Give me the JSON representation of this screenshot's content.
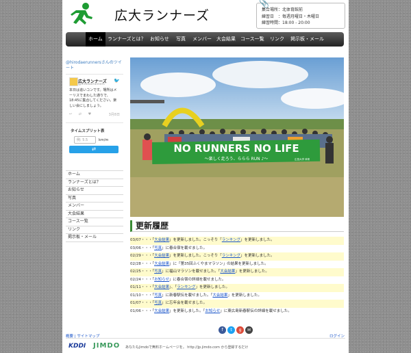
{
  "header": {
    "title": "広大ランナーズ",
    "info": {
      "place": "集合場所：北体育館前",
      "day": "練習日　：毎週月曜日・木曜日",
      "time": "練習時間：18:00 - 20:00"
    }
  },
  "nav": {
    "items": [
      "ホーム",
      "ランナーズとは？",
      "お知らせ",
      "写真",
      "メンバー",
      "大会結果",
      "コース一覧",
      "リンク",
      "掲示板・メール"
    ]
  },
  "twitter": {
    "heading": "@hirodaerunnersさんのツイート",
    "name": "広大ランナーズ",
    "handle": "@hirodaerunners",
    "body": "本日は追いコンです。場所はメーリスでまわした通りで、18:45に集合してください。楽しい会にしましょう。",
    "time": "3月8日"
  },
  "split": {
    "title": "タイムスプリット表",
    "label": "km/h",
    "placeholder": "例: 5.5",
    "unit": "km/m",
    "button": "⇄"
  },
  "sidenav": {
    "items": [
      "ホーム",
      "ランナーズとは？",
      "お知らせ",
      "写真",
      "メンバー",
      "大会結果",
      "コース一覧",
      "リンク",
      "掲示板・メール"
    ]
  },
  "hero": {
    "banner_main": "NO RUNNERS NO LIFE",
    "banner_sub": "〜楽しく走ろう、ららら RUN ♪〜",
    "banner_side": "広島大学 体育"
  },
  "main": {
    "section_title": "更新履歴",
    "updates": [
      {
        "date": "03/07",
        "pre": "・・・「",
        "link1": "大会結果",
        "mid": "」を更新しました。こっそり「",
        "link2": "ランキング",
        "post": "」を更新しました。"
      },
      {
        "date": "03/06",
        "pre": "・・・「",
        "link1": "写真",
        "mid": "」に春合宿を載せました。",
        "link2": "",
        "post": ""
      },
      {
        "date": "02/29",
        "pre": "・・・「",
        "link1": "大会結果",
        "mid": "」を更新しました。こっそり「",
        "link2": "ランキング",
        "post": "」を更新しました。"
      },
      {
        "date": "02/28",
        "pre": "・・・「",
        "link1": "大会結果",
        "mid": "」に「第35回ふくやまマラソン」の結果を更新しました。",
        "link2": "",
        "post": ""
      },
      {
        "date": "02/25",
        "pre": "・・・「",
        "link1": "写真",
        "mid": "」に福山マラソンを載せました。「",
        "link2": "大会結果",
        "post": "」を更新しました。"
      },
      {
        "date": "02/24",
        "pre": "・・・「",
        "link1": "お知らせ",
        "mid": "」に春合宿の詳細を載せました。",
        "link2": "",
        "post": ""
      },
      {
        "date": "01/11",
        "pre": "・・・「",
        "link1": "大会結果",
        "mid": "」、「",
        "link2": "ランキング",
        "post": "」を更新しました。"
      },
      {
        "date": "01/10",
        "pre": "・・・「",
        "link1": "写真",
        "mid": "」に新春駅伝を載せました。「",
        "link2": "大会結果",
        "post": "」を更新しました。"
      },
      {
        "date": "01/07",
        "pre": "・・・「",
        "link1": "写真",
        "mid": "」に忘年会を載せました。",
        "link2": "",
        "post": ""
      },
      {
        "date": "01/06",
        "pre": "・・・「",
        "link1": "大会結果",
        "mid": "」を更新しました。「",
        "link2": "お知らせ",
        "post": "」に東広島新春駅伝の詳細を載せました。"
      }
    ]
  },
  "footer": {
    "about": "概要",
    "sitemap": "サイトマップ",
    "separator": " | ",
    "login": "ログイン",
    "kddi": "KDDI",
    "jimdo": "JIMDO",
    "text": "あなたもJimdoで無料ホームページを。 http://jp.jimdo.com から登録するだけ"
  },
  "colors": {
    "accent": "#3a8b35",
    "link": "#1a55c9",
    "highlight": "#fffbcc",
    "banner": "#2e9b3c"
  }
}
